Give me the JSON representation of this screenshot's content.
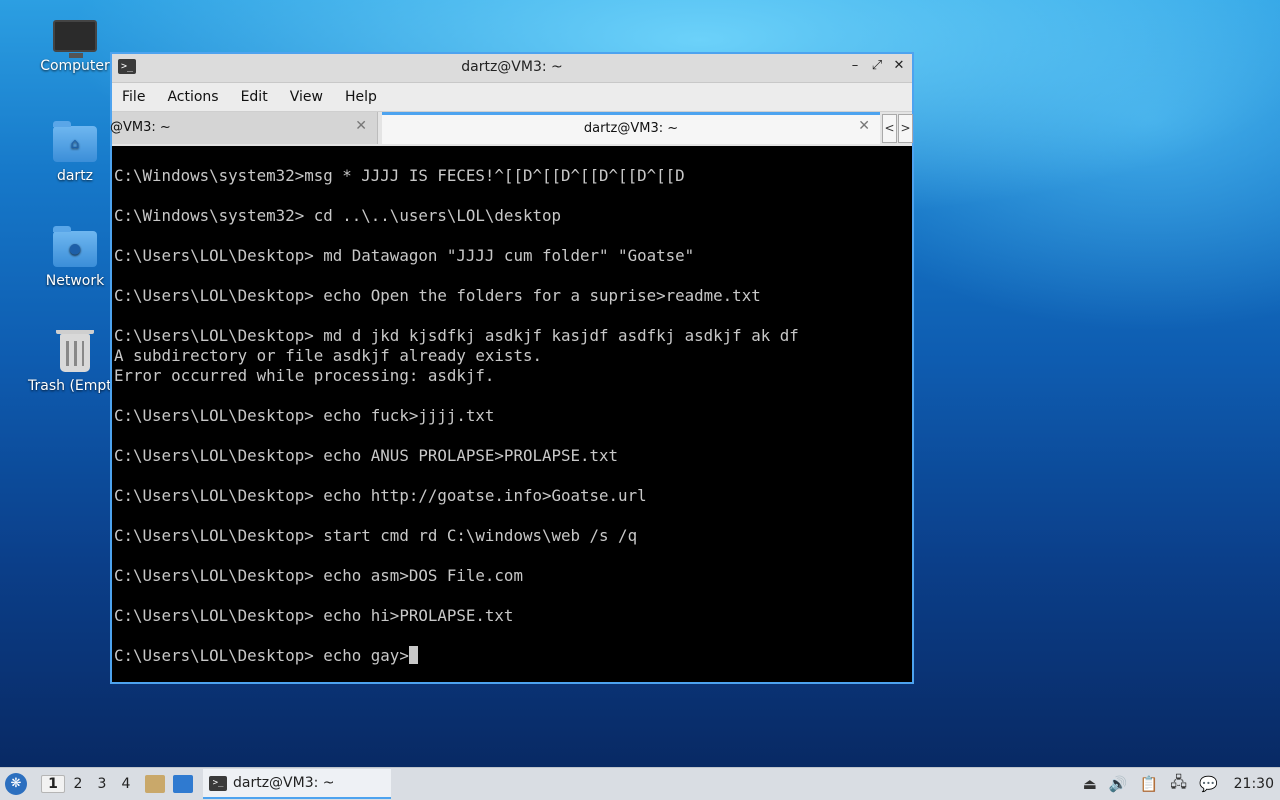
{
  "desktop": {
    "icons": [
      {
        "label": "Computer",
        "icon": "computer-icon"
      },
      {
        "label": "dartz",
        "icon": "home-folder-icon"
      },
      {
        "label": "Network",
        "icon": "network-folder-icon"
      },
      {
        "label": "Trash (Empty)",
        "icon": "trash-icon"
      }
    ]
  },
  "window": {
    "title": "dartz@VM3: ~",
    "controls": {
      "minimize": "–",
      "maximize": "⤢",
      "close": "✕"
    },
    "menu": [
      "File",
      "Actions",
      "Edit",
      "View",
      "Help"
    ],
    "tabs": [
      {
        "label": "@VM3: ~",
        "active": false
      },
      {
        "label": "dartz@VM3: ~",
        "active": true
      }
    ],
    "tab_nav": {
      "prev": "<",
      "next": ">"
    }
  },
  "terminal": {
    "lines": [
      "C:\\Windows\\system32>msg * JJJJ IS FECES!^[[D^[[D^[[D^[[D^[[D",
      "",
      "C:\\Windows\\system32> cd ..\\..\\users\\LOL\\desktop",
      "",
      "C:\\Users\\LOL\\Desktop> md Datawagon \"JJJJ cum folder\" \"Goatse\"",
      "",
      "C:\\Users\\LOL\\Desktop> echo Open the folders for a suprise>readme.txt",
      "",
      "C:\\Users\\LOL\\Desktop> md d jkd kjsdfkj asdkjf kasjdf asdfkj asdkjf ak df",
      "A subdirectory or file asdkjf already exists.",
      "Error occurred while processing: asdkjf.",
      "",
      "C:\\Users\\LOL\\Desktop> echo fuck>jjjj.txt",
      "",
      "C:\\Users\\LOL\\Desktop> echo ANUS PROLAPSE>PROLAPSE.txt",
      "",
      "C:\\Users\\LOL\\Desktop> echo http://goatse.info>Goatse.url",
      "",
      "C:\\Users\\LOL\\Desktop> start cmd rd C:\\windows\\web /s /q",
      "",
      "C:\\Users\\LOL\\Desktop> echo asm>DOS File.com",
      "",
      "C:\\Users\\LOL\\Desktop> echo hi>PROLAPSE.txt",
      ""
    ],
    "current_input": "C:\\Users\\LOL\\Desktop> echo gay>"
  },
  "panel": {
    "workspaces": [
      "1",
      "2",
      "3",
      "4"
    ],
    "active_workspace": "1",
    "task_label": "dartz@VM3: ~",
    "clock": "21:30",
    "colors": {
      "accent": "#4da3ef",
      "panel_bg": "#d9dde3"
    }
  }
}
